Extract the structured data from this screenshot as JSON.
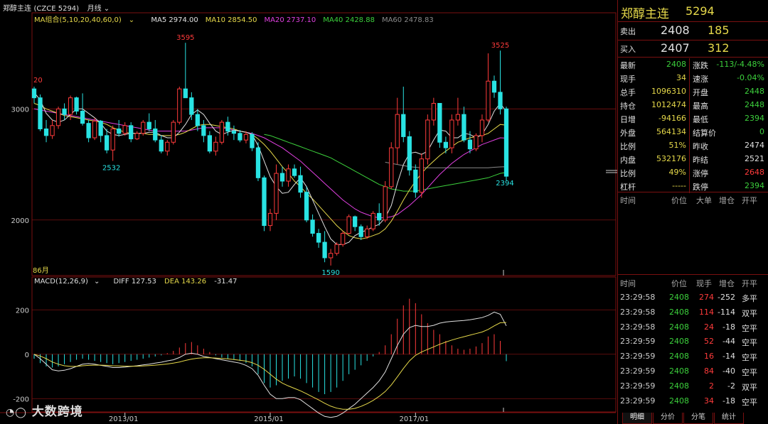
{
  "header": {
    "contract": "郑醇主连",
    "code": "(CZCE 5294)",
    "period": "月线",
    "period_icon": "chevron-down-icon"
  },
  "ma_legend": {
    "label": "MA组合(5,10,20,40,60,0)",
    "items": [
      {
        "text": "MA5 2974.00",
        "color": "#e0e0e0"
      },
      {
        "text": "MA10 2854.50",
        "color": "#e6d94a"
      },
      {
        "text": "MA20 2737.10",
        "color": "#e040e0"
      },
      {
        "text": "MA40 2428.88",
        "color": "#3cd03c"
      },
      {
        "text": "MA60 2478.83",
        "color": "#8a8a8a"
      }
    ]
  },
  "macd_legend": {
    "label": "MACD(12,26,9)",
    "diff": "DIFF 127.53",
    "dea": "DEA 143.26",
    "macd": "-31.47"
  },
  "price_annotations": {
    "high1": "3595",
    "high2": "3525",
    "low1": "2532",
    "low2": "1590",
    "last": "2394",
    "left": "20",
    "month_label": "86月"
  },
  "colors": {
    "up": "#ff3b3b",
    "down": "#29e3e3",
    "grid": "#7a1010",
    "bg": "#000000"
  },
  "chart_data": {
    "type": "candlestick",
    "y_ticks": [
      2000,
      3000
    ],
    "macd_ticks": [
      200,
      0,
      -200
    ],
    "x_ticks": [
      "2013/01",
      "2015/01",
      "2017/01"
    ],
    "ylim": [
      1500,
      3750
    ],
    "candles": [
      [
        3180,
        3200,
        3050,
        3100
      ],
      [
        3100,
        3130,
        2800,
        2820
      ],
      [
        2820,
        2900,
        2700,
        2760
      ],
      [
        2760,
        2900,
        2730,
        2850
      ],
      [
        2850,
        3020,
        2820,
        3000
      ],
      [
        3000,
        3050,
        2900,
        2950
      ],
      [
        2950,
        3120,
        2900,
        3100
      ],
      [
        3100,
        3110,
        2950,
        2980
      ],
      [
        2980,
        3140,
        2850,
        2870
      ],
      [
        2870,
        2900,
        2700,
        2740
      ],
      [
        2740,
        2920,
        2720,
        2890
      ],
      [
        2890,
        2900,
        2700,
        2760
      ],
      [
        2760,
        2820,
        2600,
        2630
      ],
      [
        2630,
        2850,
        2532,
        2820
      ],
      [
        2820,
        2900,
        2750,
        2780
      ],
      [
        2780,
        2880,
        2760,
        2850
      ],
      [
        2850,
        2880,
        2700,
        2730
      ],
      [
        2730,
        2800,
        2720,
        2780
      ],
      [
        2780,
        2900,
        2760,
        2880
      ],
      [
        2880,
        2960,
        2800,
        2820
      ],
      [
        2820,
        2900,
        2700,
        2720
      ],
      [
        2720,
        2760,
        2600,
        2620
      ],
      [
        2620,
        2720,
        2580,
        2700
      ],
      [
        2700,
        2900,
        2680,
        2880
      ],
      [
        2880,
        3200,
        2860,
        3180
      ],
      [
        3180,
        3595,
        3150,
        3100
      ],
      [
        3100,
        3150,
        2900,
        2950
      ],
      [
        2950,
        3000,
        2800,
        2850
      ],
      [
        2850,
        2900,
        2700,
        2760
      ],
      [
        2760,
        2800,
        2600,
        2620
      ],
      [
        2620,
        2750,
        2580,
        2700
      ],
      [
        2700,
        2900,
        2680,
        2880
      ],
      [
        2880,
        2930,
        2760,
        2800
      ],
      [
        2800,
        2850,
        2720,
        2780
      ],
      [
        2780,
        2810,
        2700,
        2720
      ],
      [
        2720,
        2800,
        2690,
        2770
      ],
      [
        2770,
        2790,
        2620,
        2650
      ],
      [
        2650,
        2700,
        2350,
        2380
      ],
      [
        2380,
        2400,
        1900,
        1950
      ],
      [
        1950,
        2100,
        1900,
        2060
      ],
      [
        2060,
        2500,
        2000,
        2420
      ],
      [
        2420,
        2480,
        2300,
        2350
      ],
      [
        2350,
        2500,
        2300,
        2460
      ],
      [
        2460,
        2500,
        2380,
        2400
      ],
      [
        2400,
        2480,
        2200,
        2250
      ],
      [
        2250,
        2300,
        1980,
        2000
      ],
      [
        2000,
        2050,
        1850,
        1880
      ],
      [
        1880,
        1920,
        1750,
        1800
      ],
      [
        1800,
        1900,
        1620,
        1660
      ],
      [
        1660,
        1740,
        1590,
        1700
      ],
      [
        1700,
        1800,
        1680,
        1780
      ],
      [
        1780,
        1900,
        1760,
        1880
      ],
      [
        1880,
        2050,
        1870,
        2030
      ],
      [
        2030,
        2040,
        1900,
        1940
      ],
      [
        1940,
        1960,
        1820,
        1850
      ],
      [
        1850,
        1950,
        1830,
        1920
      ],
      [
        1920,
        2080,
        1900,
        2060
      ],
      [
        2060,
        2150,
        1950,
        2000
      ],
      [
        2000,
        2350,
        1980,
        2300
      ],
      [
        2300,
        2700,
        2280,
        2650
      ],
      [
        2650,
        3100,
        2500,
        2950
      ],
      [
        2950,
        3200,
        2700,
        2750
      ],
      [
        2750,
        2800,
        2400,
        2450
      ],
      [
        2450,
        2500,
        2200,
        2250
      ],
      [
        2250,
        2600,
        2200,
        2550
      ],
      [
        2550,
        2950,
        2500,
        2900
      ],
      [
        2900,
        3100,
        2850,
        3050
      ],
      [
        3050,
        3000,
        2650,
        2700
      ],
      [
        2700,
        2750,
        2600,
        2650
      ],
      [
        2650,
        2950,
        2600,
        2900
      ],
      [
        2900,
        3100,
        2850,
        2950
      ],
      [
        2950,
        3020,
        2700,
        2720
      ],
      [
        2720,
        2800,
        2600,
        2640
      ],
      [
        2640,
        2780,
        2620,
        2760
      ],
      [
        2760,
        2950,
        2700,
        2900
      ],
      [
        2900,
        3500,
        2880,
        3250
      ],
      [
        3250,
        3300,
        3100,
        3150
      ],
      [
        3150,
        3525,
        2950,
        3000
      ],
      [
        3000,
        3020,
        2350,
        2394
      ]
    ],
    "ma5": [
      3150,
      3080,
      2960,
      2900,
      2880,
      2900,
      2950,
      3000,
      3000,
      2960,
      2920,
      2870,
      2800,
      2770,
      2760,
      2770,
      2780,
      2780,
      2780,
      2790,
      2790,
      2760,
      2740,
      2740,
      2790,
      2860,
      2950,
      2990,
      2950,
      2870,
      2800,
      2770,
      2790,
      2810,
      2800,
      2790,
      2770,
      2670,
      2530,
      2390,
      2300,
      2240,
      2250,
      2320,
      2380,
      2300,
      2180,
      2060,
      1940,
      1830,
      1780,
      1780,
      1800,
      1860,
      1890,
      1910,
      1940,
      1960,
      2020,
      2130,
      2330,
      2500,
      2600,
      2610,
      2590,
      2620,
      2720,
      2810,
      2800,
      2740,
      2740,
      2780,
      2770,
      2740,
      2770,
      2860,
      2980,
      3050,
      2974
    ],
    "ma10": [
      3050,
      3030,
      3000,
      2980,
      2960,
      2940,
      2930,
      2920,
      2910,
      2900,
      2890,
      2880,
      2860,
      2830,
      2810,
      2790,
      2780,
      2780,
      2780,
      2770,
      2770,
      2760,
      2760,
      2760,
      2770,
      2790,
      2820,
      2850,
      2860,
      2860,
      2850,
      2840,
      2830,
      2820,
      2800,
      2790,
      2770,
      2730,
      2680,
      2620,
      2550,
      2480,
      2420,
      2350,
      2300,
      2240,
      2190,
      2130,
      2070,
      2010,
      1950,
      1900,
      1860,
      1840,
      1830,
      1840,
      1860,
      1880,
      1920,
      1990,
      2080,
      2180,
      2270,
      2350,
      2420,
      2480,
      2530,
      2580,
      2620,
      2660,
      2700,
      2720,
      2740,
      2750,
      2760,
      2780,
      2820,
      2860,
      2854
    ],
    "ma20": [
      3000,
      2990,
      2980,
      2970,
      2960,
      2950,
      2940,
      2930,
      2920,
      2910,
      2900,
      2890,
      2880,
      2870,
      2860,
      2850,
      2840,
      2830,
      2820,
      2810,
      2800,
      2800,
      2800,
      2800,
      2800,
      2800,
      2810,
      2820,
      2830,
      2830,
      2830,
      2830,
      2820,
      2810,
      2800,
      2790,
      2780,
      2760,
      2740,
      2710,
      2680,
      2650,
      2610,
      2570,
      2530,
      2480,
      2430,
      2380,
      2330,
      2280,
      2230,
      2180,
      2140,
      2100,
      2070,
      2050,
      2030,
      2020,
      2020,
      2030,
      2050,
      2090,
      2130,
      2180,
      2230,
      2290,
      2350,
      2410,
      2460,
      2510,
      2550,
      2590,
      2620,
      2650,
      2680,
      2700,
      2720,
      2740,
      2737
    ],
    "ma40": [
      null,
      null,
      null,
      null,
      null,
      null,
      null,
      null,
      null,
      null,
      null,
      null,
      null,
      null,
      null,
      null,
      null,
      null,
      null,
      null,
      null,
      null,
      null,
      null,
      null,
      null,
      null,
      null,
      null,
      null,
      null,
      null,
      null,
      null,
      null,
      null,
      null,
      null,
      2770,
      2760,
      2740,
      2720,
      2700,
      2680,
      2660,
      2640,
      2620,
      2600,
      2580,
      2560,
      2530,
      2500,
      2470,
      2440,
      2410,
      2380,
      2350,
      2320,
      2300,
      2280,
      2270,
      2260,
      2260,
      2260,
      2270,
      2280,
      2290,
      2300,
      2310,
      2320,
      2330,
      2340,
      2350,
      2360,
      2370,
      2380,
      2400,
      2420,
      2429
    ],
    "ma60": [
      null,
      null,
      null,
      null,
      null,
      null,
      null,
      null,
      null,
      null,
      null,
      null,
      null,
      null,
      null,
      null,
      null,
      null,
      null,
      null,
      null,
      null,
      null,
      null,
      null,
      null,
      null,
      null,
      null,
      null,
      null,
      null,
      null,
      null,
      null,
      null,
      null,
      null,
      null,
      null,
      null,
      null,
      null,
      null,
      null,
      null,
      null,
      null,
      null,
      null,
      null,
      null,
      null,
      null,
      null,
      null,
      null,
      null,
      2520,
      2510,
      2500,
      2490,
      2480,
      2475,
      2470,
      2470,
      2470,
      2470,
      2470,
      2470,
      2470,
      2470,
      2470,
      2470,
      2470,
      2470,
      2475,
      2478,
      2479
    ],
    "macd_hist": [
      -20,
      -40,
      -55,
      -60,
      -55,
      -45,
      -35,
      -25,
      -20,
      -25,
      -30,
      -35,
      -40,
      -45,
      -40,
      -35,
      -30,
      -25,
      -20,
      -15,
      -10,
      -5,
      5,
      15,
      30,
      50,
      55,
      40,
      25,
      10,
      -5,
      -15,
      -20,
      -25,
      -30,
      -40,
      -55,
      -90,
      -130,
      -150,
      -140,
      -120,
      -110,
      -100,
      -110,
      -130,
      -150,
      -170,
      -180,
      -170,
      -150,
      -120,
      -90,
      -70,
      -50,
      -30,
      -10,
      10,
      40,
      90,
      160,
      220,
      250,
      230,
      180,
      140,
      110,
      90,
      60,
      40,
      25,
      20,
      25,
      35,
      50,
      80,
      90,
      60,
      -31
    ],
    "diff": [
      0,
      -20,
      -45,
      -70,
      -75,
      -72,
      -65,
      -55,
      -45,
      -42,
      -45,
      -50,
      -55,
      -60,
      -60,
      -58,
      -55,
      -52,
      -48,
      -45,
      -40,
      -36,
      -30,
      -25,
      -15,
      0,
      5,
      0,
      -10,
      -15,
      -20,
      -25,
      -30,
      -35,
      -40,
      -50,
      -65,
      -95,
      -140,
      -180,
      -200,
      -200,
      -195,
      -195,
      -205,
      -225,
      -245,
      -265,
      -280,
      -285,
      -280,
      -265,
      -245,
      -225,
      -200,
      -175,
      -150,
      -120,
      -80,
      -20,
      40,
      90,
      120,
      130,
      125,
      125,
      130,
      140,
      145,
      148,
      150,
      152,
      155,
      160,
      165,
      175,
      190,
      180,
      128
    ],
    "dea": [
      0,
      -8,
      -20,
      -35,
      -45,
      -52,
      -55,
      -55,
      -52,
      -50,
      -49,
      -49,
      -50,
      -52,
      -53,
      -54,
      -54,
      -54,
      -53,
      -51,
      -49,
      -47,
      -44,
      -40,
      -35,
      -28,
      -22,
      -18,
      -16,
      -16,
      -17,
      -19,
      -21,
      -24,
      -27,
      -31,
      -38,
      -50,
      -68,
      -90,
      -112,
      -130,
      -143,
      -154,
      -165,
      -178,
      -192,
      -206,
      -221,
      -234,
      -243,
      -248,
      -248,
      -244,
      -235,
      -223,
      -208,
      -190,
      -168,
      -138,
      -102,
      -64,
      -30,
      -5,
      10,
      22,
      33,
      45,
      55,
      64,
      72,
      79,
      86,
      93,
      100,
      112,
      128,
      142,
      143
    ]
  },
  "panel": {
    "title": "郑醇主连",
    "code": "5294",
    "sell": {
      "label": "卖出",
      "price": "2408",
      "vol": "185"
    },
    "buy": {
      "label": "买入",
      "price": "2407",
      "vol": "312"
    },
    "quotes": [
      [
        {
          "k": "最新",
          "v": "2408",
          "c": "#3cd03c"
        },
        {
          "k": "涨跌",
          "v": "-113/-4.48%",
          "c": "#3cd03c"
        }
      ],
      [
        {
          "k": "现手",
          "v": "34",
          "c": "#e6d94a"
        },
        {
          "k": "速涨",
          "v": "-0.04%",
          "c": "#3cd03c"
        }
      ],
      [
        {
          "k": "总手",
          "v": "1096310",
          "c": "#e6d94a"
        },
        {
          "k": "开盘",
          "v": "2448",
          "c": "#3cd03c"
        }
      ],
      [
        {
          "k": "持仓",
          "v": "1012474",
          "c": "#e6d94a"
        },
        {
          "k": "最高",
          "v": "2448",
          "c": "#3cd03c"
        }
      ],
      [
        {
          "k": "日增",
          "v": "-94166",
          "c": "#e6d94a"
        },
        {
          "k": "最低",
          "v": "2394",
          "c": "#3cd03c"
        }
      ],
      [
        {
          "k": "外盘",
          "v": "564134",
          "c": "#e6d94a"
        },
        {
          "k": "结算价",
          "v": "0",
          "c": "#3cd03c"
        }
      ],
      [
        {
          "k": "比例",
          "v": "51%",
          "c": "#e6d94a"
        },
        {
          "k": "昨收",
          "v": "2474",
          "c": "#e0e0e0"
        }
      ],
      [
        {
          "k": "内盘",
          "v": "532176",
          "c": "#e6d94a"
        },
        {
          "k": "昨结",
          "v": "2521",
          "c": "#e0e0e0"
        }
      ],
      [
        {
          "k": "比例",
          "v": "49%",
          "c": "#e6d94a"
        },
        {
          "k": "涨停",
          "v": "2648",
          "c": "#ff3b3b"
        }
      ],
      [
        {
          "k": "杠杆",
          "v": "-----",
          "c": "#e6d94a"
        },
        {
          "k": "跌停",
          "v": "2394",
          "c": "#3cd03c"
        }
      ]
    ],
    "bigorder_headers": [
      "时间",
      "价位",
      "大单",
      "增仓",
      "开平"
    ],
    "trade_headers": [
      "时间",
      "价位",
      "现手",
      "增仓",
      "开平"
    ],
    "trades": [
      {
        "time": "23:29:58",
        "price": "2408",
        "vol": "274",
        "inc": "-252",
        "type": "多平",
        "vc": "#ff3b3b"
      },
      {
        "time": "23:29:58",
        "price": "2408",
        "vol": "114",
        "inc": "-114",
        "type": "双平",
        "vc": "#ff3b3b"
      },
      {
        "time": "23:29:58",
        "price": "2408",
        "vol": "24",
        "inc": "-18",
        "type": "空平",
        "vc": "#ff3b3b"
      },
      {
        "time": "23:29:59",
        "price": "2408",
        "vol": "52",
        "inc": "-44",
        "type": "空平",
        "vc": "#ff3b3b"
      },
      {
        "time": "23:29:59",
        "price": "2408",
        "vol": "16",
        "inc": "-14",
        "type": "空平",
        "vc": "#ff3b3b"
      },
      {
        "time": "23:29:59",
        "price": "2408",
        "vol": "84",
        "inc": "-40",
        "type": "空平",
        "vc": "#ff3b3b"
      },
      {
        "time": "23:29:59",
        "price": "2408",
        "vol": "2",
        "inc": "-2",
        "type": "双平",
        "vc": "#ff3b3b"
      },
      {
        "time": "23:29:59",
        "price": "2408",
        "vol": "34",
        "inc": "-18",
        "type": "空平",
        "vc": "#ff3b3b"
      }
    ],
    "tabs": [
      "明细",
      "分价",
      "分笔",
      "统计"
    ]
  },
  "watermark": "大数跨境"
}
